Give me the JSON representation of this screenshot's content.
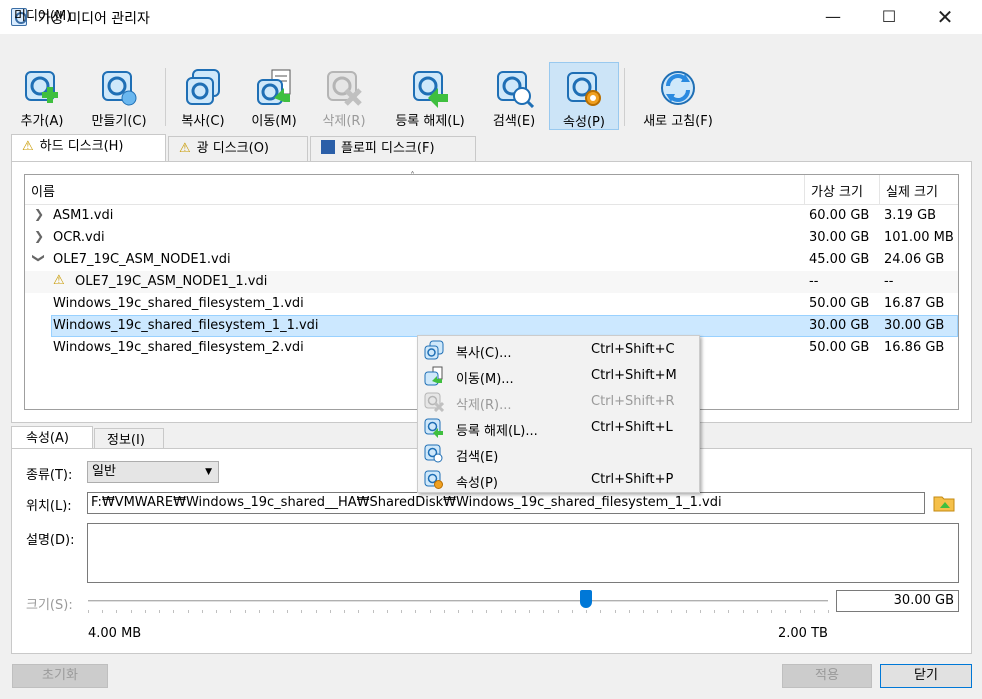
{
  "window": {
    "title": "가상 미디어 관리자"
  },
  "menu": {
    "media": "미디어(M)"
  },
  "toolbar": {
    "add": "추가(A)",
    "create": "만들기(C)",
    "copy": "복사(C)",
    "move": "이동(M)",
    "remove": "삭제(R)",
    "release": "등록 해제(L)",
    "search": "검색(E)",
    "properties": "속성(P)",
    "refresh": "새로 고침(F)"
  },
  "tabs": {
    "hard_disks": "하드 디스크(H)",
    "optical_disks": "광 디스크(O)",
    "floppy_disks": "플로피 디스크(F)"
  },
  "table": {
    "columns": {
      "name": "이름",
      "virtual_size": "가상 크기",
      "actual_size": "실제 크기"
    },
    "rows": [
      {
        "name": "ASM1.vdi",
        "virtual_size": "60.00 GB",
        "actual_size": "3.19 GB"
      },
      {
        "name": "OCR.vdi",
        "virtual_size": "30.00 GB",
        "actual_size": "101.00 MB"
      },
      {
        "name": "OLE7_19C_ASM_NODE1.vdi",
        "virtual_size": "45.00 GB",
        "actual_size": "24.06 GB"
      },
      {
        "name": "OLE7_19C_ASM_NODE1_1.vdi",
        "virtual_size": "--",
        "actual_size": "--"
      },
      {
        "name": "Windows_19c_shared_filesystem_1.vdi",
        "virtual_size": "50.00 GB",
        "actual_size": "16.87 GB"
      },
      {
        "name": "Windows_19c_shared_filesystem_1_1.vdi",
        "virtual_size": "30.00 GB",
        "actual_size": "30.00 GB"
      },
      {
        "name": "Windows_19c_shared_filesystem_2.vdi",
        "virtual_size": "50.00 GB",
        "actual_size": "16.86 GB"
      }
    ]
  },
  "context_menu": [
    {
      "label": "복사(C)...",
      "shortcut": "Ctrl+Shift+C"
    },
    {
      "label": "이동(M)...",
      "shortcut": "Ctrl+Shift+M"
    },
    {
      "label": "삭제(R)...",
      "shortcut": "Ctrl+Shift+R"
    },
    {
      "label": "등록 해제(L)...",
      "shortcut": "Ctrl+Shift+L"
    },
    {
      "label": "검색(E)",
      "shortcut": ""
    },
    {
      "label": "속성(P)",
      "shortcut": "Ctrl+Shift+P"
    }
  ],
  "details": {
    "tab_properties": "속성(A)",
    "tab_info": "정보(I)",
    "type_label": "종류(T):",
    "type_value": "일반",
    "location_label": "위치(L):",
    "location_value": "F:₩VMWARE₩Windows_19c_shared__HA₩SharedDisk₩Windows_19c_shared_filesystem_1_1.vdi",
    "description_label": "설명(D):",
    "size_label": "크기(S):",
    "size_value": "30.00 GB",
    "size_fraction": 0.673,
    "size_min": "4.00 MB",
    "size_max": "2.00 TB"
  },
  "buttons": {
    "reset": "초기화",
    "apply": "적용",
    "close": "닫기"
  },
  "colors": {
    "accent": "#0078d7",
    "selection": "#cce8ff"
  }
}
